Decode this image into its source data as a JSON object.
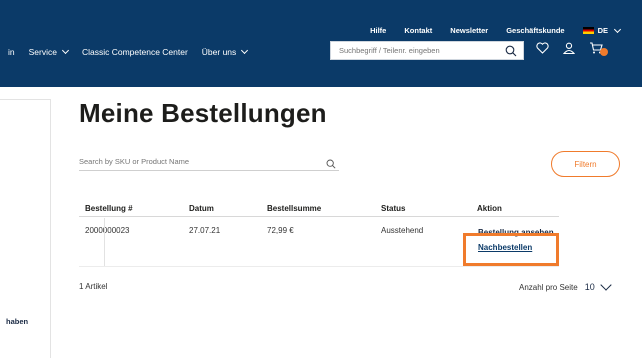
{
  "topbar": {
    "links": [
      "Hilfe",
      "Kontakt",
      "Newsletter",
      "Geschäftskunde"
    ],
    "language": "DE"
  },
  "nav": {
    "first_fragment": "in",
    "items": [
      "Service",
      "Classic Competence Center",
      "Über uns"
    ]
  },
  "header_search": {
    "placeholder": "Suchbegriff / Teilenr. eingeben"
  },
  "sidebar": {
    "fragment": "haben"
  },
  "page": {
    "title": "Meine Bestellungen"
  },
  "order_search": {
    "placeholder": "Search by SKU or Product Name"
  },
  "filter_label": "Filtern",
  "table": {
    "headers": [
      "Bestellung #",
      "Datum",
      "Bestellsumme",
      "Status",
      "Aktion"
    ],
    "rows": [
      {
        "order": "2000000023",
        "date": "27.07.21",
        "total": "72,99 €",
        "status": "Ausstehend",
        "action_view": "Bestellung ansehen",
        "action_reorder": "Nachbestellen"
      }
    ]
  },
  "footer": {
    "count": "1 Artikel",
    "per_page_label": "Anzahl pro Seite",
    "per_page_value": "10"
  },
  "colors": {
    "header": "#0b3a68",
    "accent": "#f07b2c"
  }
}
